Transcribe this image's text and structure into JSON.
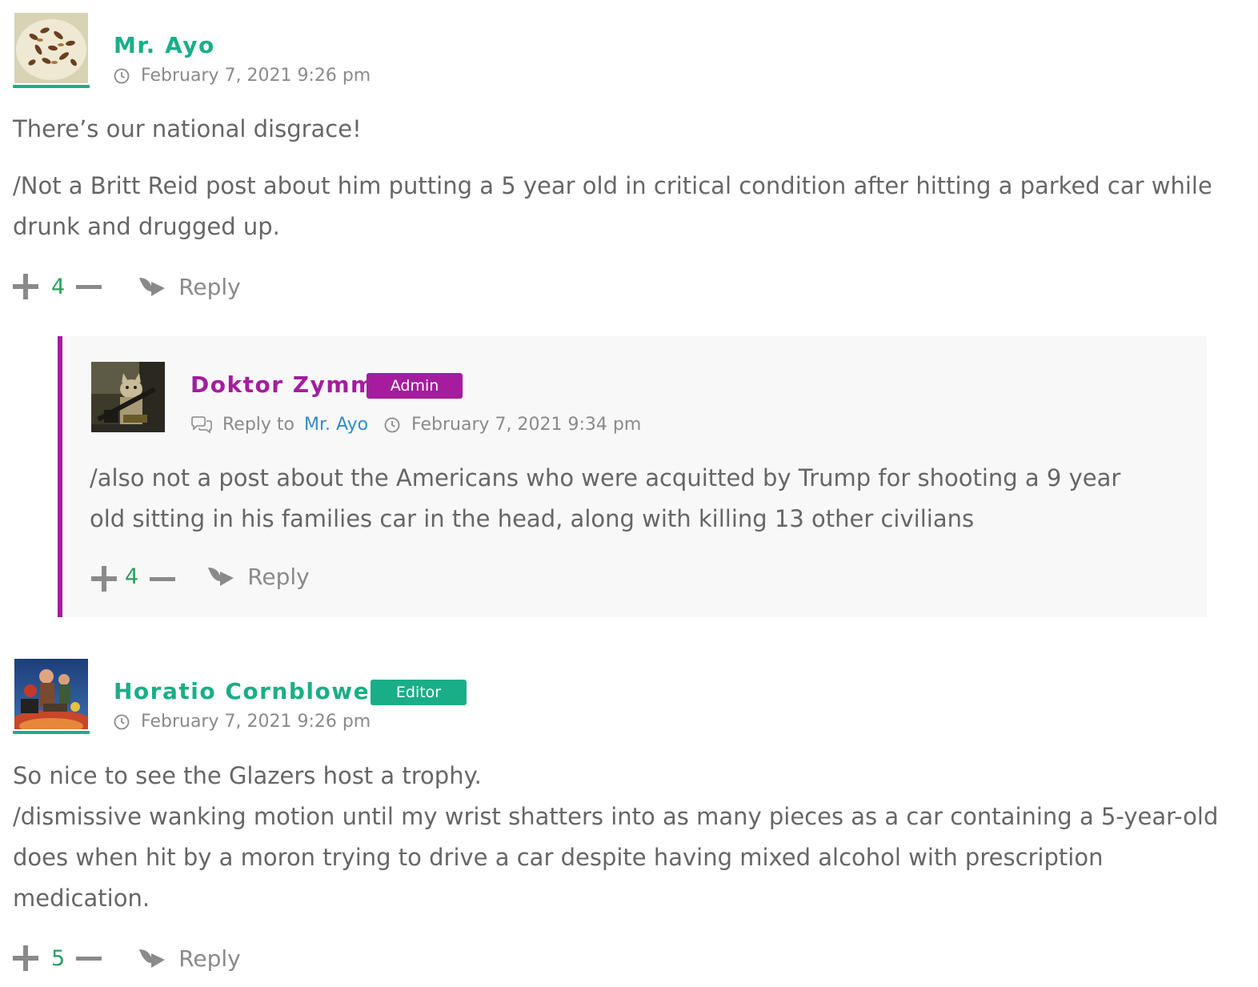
{
  "colors": {
    "green_accent": "#1aae87",
    "admin_purple": "#a51c9e",
    "link_blue": "#2e8ec8",
    "vote_green": "#2aa05a",
    "text_gray": "#666666"
  },
  "comments": [
    {
      "author": "Mr. Ayo",
      "timestamp": "February 7, 2021 9:26 pm",
      "paragraphs": [
        "There’s our national disgrace!",
        "/Not a Britt Reid post about him putting a 5 year old in critical condition after hitting a parked car while drunk and drugged up."
      ],
      "votes": "4",
      "reply_label": "Reply",
      "icons": [
        "clock-icon",
        "plus-icon",
        "minus-icon",
        "reply-arrow-icon"
      ]
    },
    {
      "author": "Doktor Zymm",
      "badge": "Admin",
      "reply_to_label": "Reply to",
      "reply_to_author": "Mr. Ayo",
      "timestamp": "February 7, 2021 9:34 pm",
      "paragraphs": [
        "/also not a post about the Americans who were acquitted by Trump for shooting a 9 year old sitting in his families car in the head, along with killing 13 other civilians"
      ],
      "votes": "4",
      "reply_label": "Reply",
      "icons": [
        "speech-bubbles-icon",
        "clock-icon",
        "plus-icon",
        "minus-icon",
        "reply-arrow-icon"
      ]
    },
    {
      "author": "Horatio Cornblower",
      "badge": "Editor",
      "timestamp": "February 7, 2021 9:26 pm",
      "paragraphs": [
        "So nice to see the Glazers host a trophy.",
        "/dismissive wanking motion until my wrist shatters into as many pieces as a car containing a 5-year-old does when hit by a moron trying to drive a car despite having mixed alcohol with prescription medication."
      ],
      "votes": "5",
      "reply_label": "Reply",
      "icons": [
        "clock-icon",
        "plus-icon",
        "minus-icon",
        "reply-arrow-icon"
      ]
    }
  ]
}
